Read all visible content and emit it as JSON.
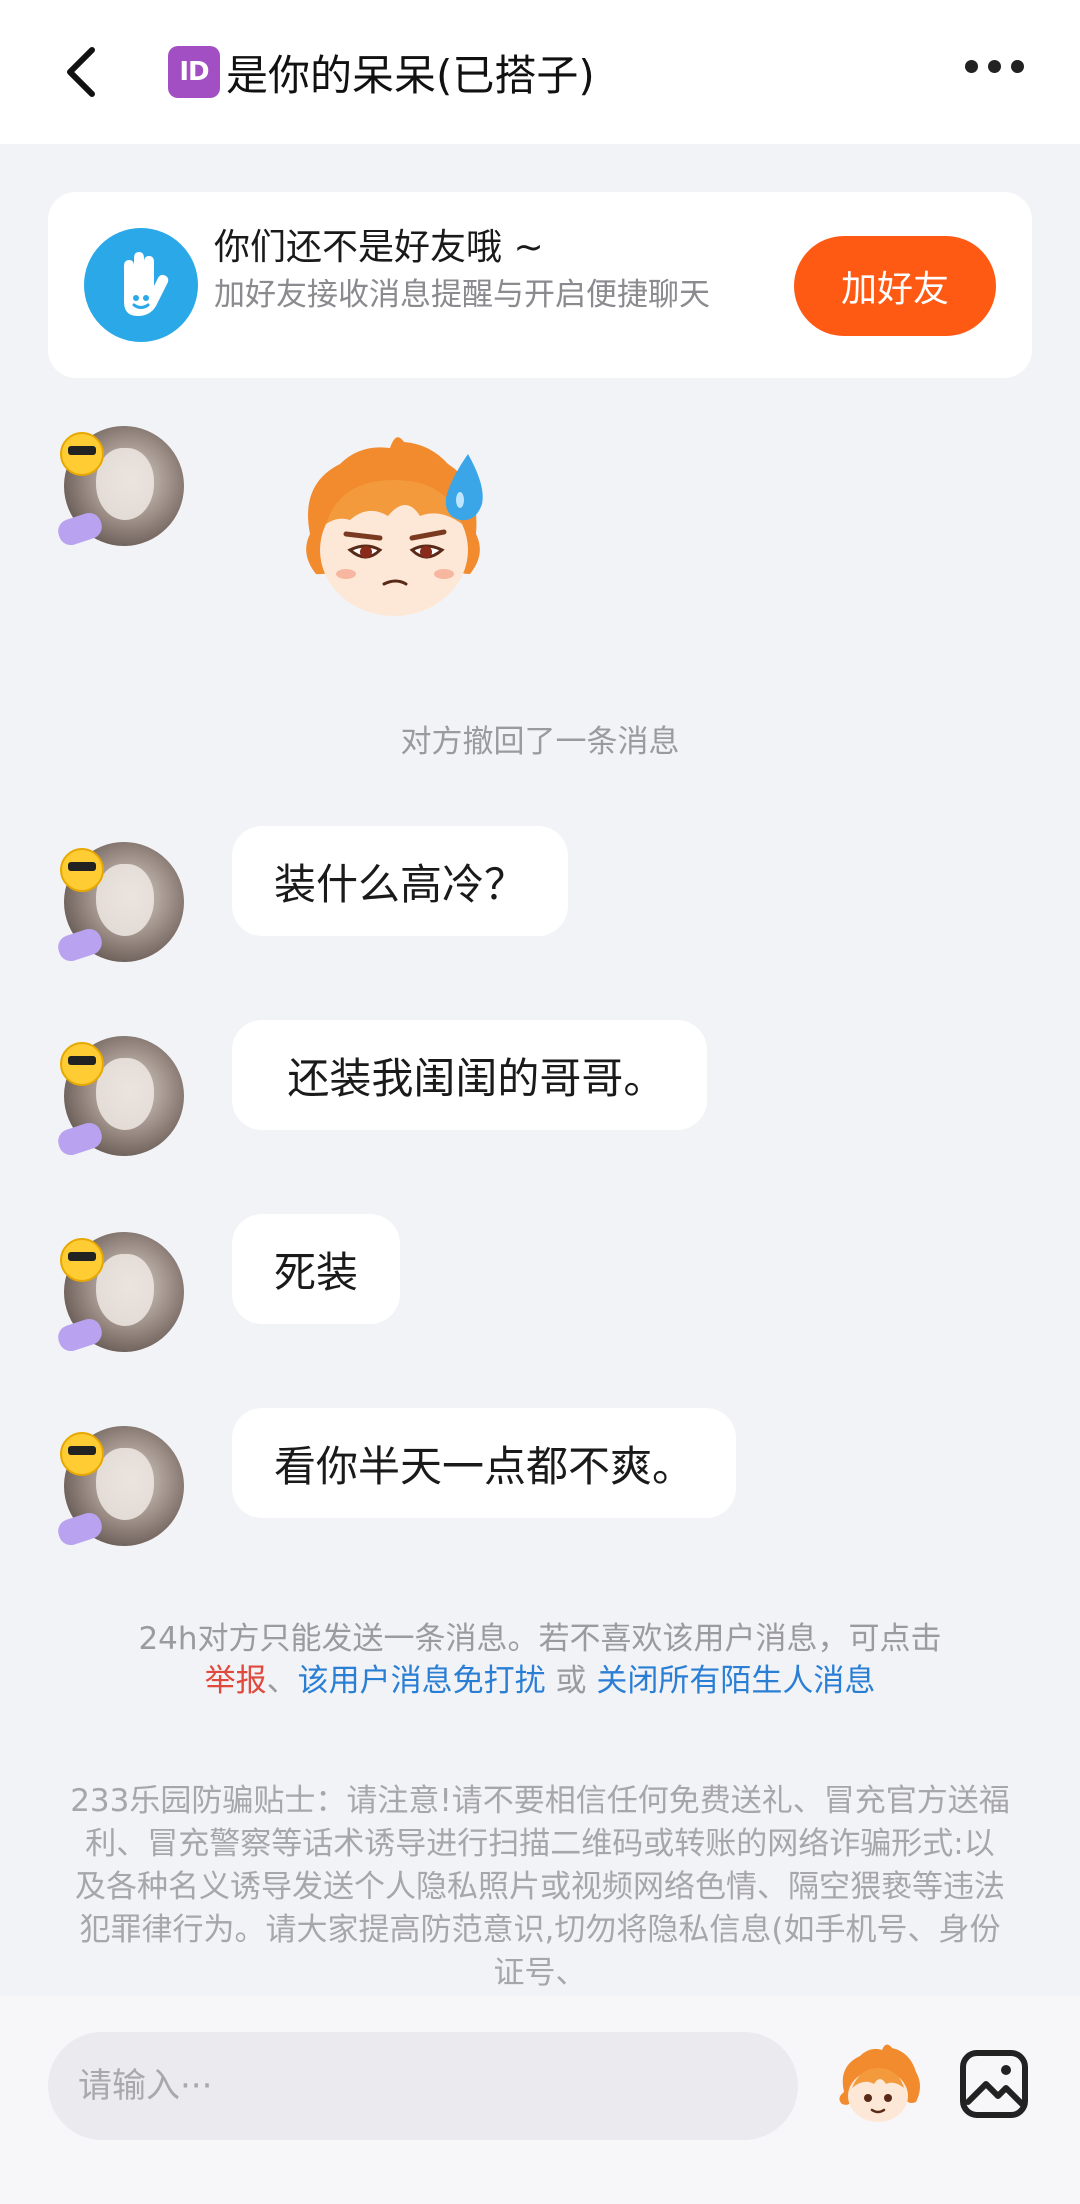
{
  "header": {
    "back_icon": "chevron-left-icon",
    "id_badge": "ID",
    "title": "是你的呆呆(已搭子)",
    "more_icon": "more-horizontal-icon"
  },
  "friend_card": {
    "title": "你们还不是好友哦 ~",
    "subtitle": "加好友接收消息提醒与开启便捷聊天",
    "button": "加好友",
    "button_color": "#ff5a14"
  },
  "system_note": "对方撤回了一条消息",
  "messages": [
    {
      "type": "sticker",
      "name": "sweat-emoji-sticker"
    },
    {
      "type": "text",
      "text": "装什么高冷？"
    },
    {
      "type": "text",
      "text": " 还装我闺闺的哥哥。"
    },
    {
      "type": "text",
      "text": "死装"
    },
    {
      "type": "text",
      "text": "看你半天一点都不爽。"
    }
  ],
  "notice": {
    "prefix": "24h对方只能发送一条消息。若不喜欢该用户消息，可点击",
    "report": "举报",
    "sep1": "、",
    "mute_user": "该用户消息免打扰",
    "or": " 或 ",
    "close_all": "关闭所有陌生人消息"
  },
  "tips": "233乐园防骗贴士：请注意!请不要相信任何免费送礼、冒充官方送福利、冒充警察等话术诱导进行扫描二维码或转账的网络诈骗形式:以及各种名义诱导发送个人隐私照片或视频网络色情、隔空猥亵等违法犯罪律行为。请大家提高防范意识,切勿将隐私信息(如手机号、身份证号、",
  "input": {
    "placeholder": "请输入···",
    "emoji_icon": "sticker-face-icon",
    "image_icon": "image-icon"
  }
}
